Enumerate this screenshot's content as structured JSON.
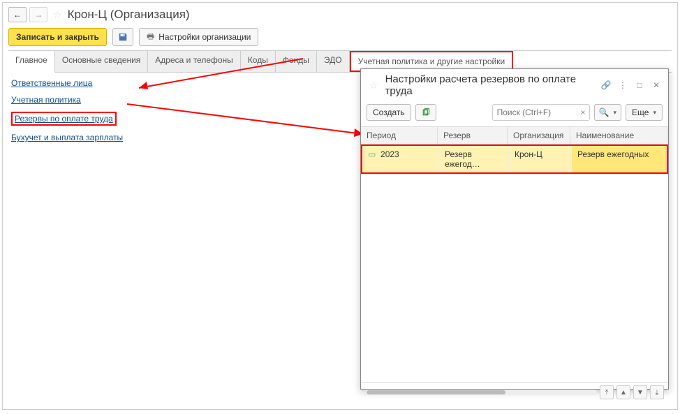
{
  "header": {
    "title": "Крон-Ц (Организация)"
  },
  "toolbar": {
    "save_close": "Записать и закрыть",
    "org_settings": "Настройки организации"
  },
  "tabs": [
    {
      "label": "Главное",
      "active": true,
      "hl": false
    },
    {
      "label": "Основные сведения",
      "active": false,
      "hl": false
    },
    {
      "label": "Адреса и телефоны",
      "active": false,
      "hl": false
    },
    {
      "label": "Коды",
      "active": false,
      "hl": false
    },
    {
      "label": "Фонды",
      "active": false,
      "hl": false
    },
    {
      "label": "ЭДО",
      "active": false,
      "hl": false
    },
    {
      "label": "Учетная политика и другие настройки",
      "active": false,
      "hl": true
    }
  ],
  "links": [
    {
      "label": "Ответственные лица",
      "hl": false
    },
    {
      "label": "Учетная политика",
      "hl": false
    },
    {
      "label": "Резервы по оплате труда",
      "hl": true
    },
    {
      "label": "Бухучет и выплата зарплаты",
      "hl": false
    }
  ],
  "popup": {
    "title": "Настройки расчета резервов по оплате труда",
    "create": "Создать",
    "search_ph": "Поиск (Ctrl+F)",
    "more": "Еще",
    "cols": {
      "c1": "Период",
      "c2": "Резерв",
      "c3": "Организация",
      "c4": "Наименование"
    },
    "row": {
      "period": "2023",
      "reserve": "Резерв ежегод…",
      "org": "Крон-Ц",
      "name": "Резерв ежегодных"
    }
  }
}
